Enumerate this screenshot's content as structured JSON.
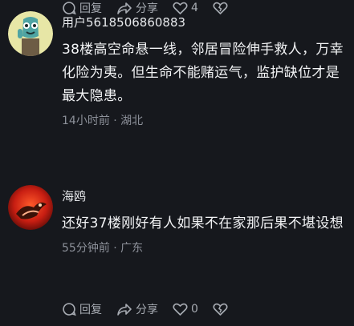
{
  "comments": [
    {
      "username": "用户5618506860883",
      "text": "38楼高空命悬一线，邻居冒险伸手救人，万幸化险为夷。但生命不能赌运气，监护缺位才是最大隐患。",
      "meta": "14小时前 · 湖北",
      "reply_label": "回复",
      "share_label": "分享",
      "likes": "4",
      "avatar_icon": "cartoon-creature-avatar"
    },
    {
      "username": "海鸥",
      "text": "还好37楼刚好有人如果不在家那后果不堪设想",
      "meta": "55分钟前 · 广东",
      "reply_label": "回复",
      "share_label": "分享",
      "likes": "0",
      "avatar_icon": "red-seagull-avatar"
    }
  ],
  "icons": {
    "reply": "reply-bubble-icon",
    "share": "share-arrow-icon",
    "like": "heart-icon",
    "dislike": "broken-heart-icon"
  },
  "colors": {
    "background": "#16181d",
    "text": "#f2f3f5",
    "meta": "#8c9099",
    "action": "#a7abb2"
  }
}
